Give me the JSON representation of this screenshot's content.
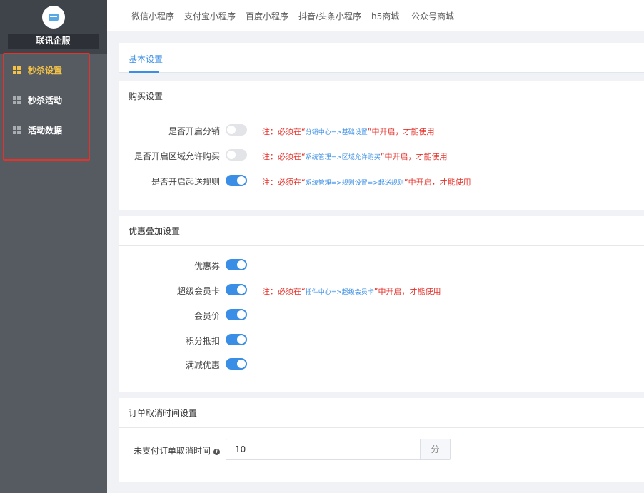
{
  "sidebar": {
    "brand": "联讯企服",
    "items": [
      {
        "label": "秒杀设置",
        "active": true
      },
      {
        "label": "秒杀活动",
        "active": false
      },
      {
        "label": "活动数据",
        "active": false
      }
    ]
  },
  "topbar": {
    "tabs": [
      "微信小程序",
      "支付宝小程序",
      "百度小程序",
      "抖音/头条小程序",
      "h5商城",
      "公众号商城"
    ]
  },
  "basic": {
    "tab_label": "基本设置"
  },
  "purchase": {
    "title": "购买设置",
    "rows": [
      {
        "label": "是否开启分销",
        "on": false,
        "note_prefix": "注：必须在“",
        "note_path": "分销中心=>基础设置",
        "note_suffix": "”中开启，才能使用"
      },
      {
        "label": "是否开启区域允许购买",
        "on": false,
        "note_prefix": "注：必须在“",
        "note_path": "系统管理=>区域允许购买",
        "note_suffix": "”中开启，才能使用"
      },
      {
        "label": "是否开启起送规则",
        "on": true,
        "note_prefix": "注：必须在“",
        "note_path": "系统管理=>规则设置=>起送规则",
        "note_suffix": "”中开启，才能使用"
      }
    ]
  },
  "discount": {
    "title": "优惠叠加设置",
    "rows": [
      {
        "label": "优惠券",
        "on": true
      },
      {
        "label": "超级会员卡",
        "on": true,
        "note_prefix": "注：必须在“",
        "note_path": "插件中心=>超级会员卡",
        "note_suffix": "”中开启，才能使用"
      },
      {
        "label": "会员价",
        "on": true
      },
      {
        "label": "积分抵扣",
        "on": true
      },
      {
        "label": "满减优惠",
        "on": true
      }
    ]
  },
  "cancel": {
    "title": "订单取消时间设置",
    "label": "未支付订单取消时间",
    "info_icon": "i",
    "value": "10",
    "unit": "分"
  },
  "colors": {
    "accent": "#3a8ee6",
    "warning": "#e5322b",
    "active_menu": "#f3c247",
    "sidebar": "#565b61"
  }
}
